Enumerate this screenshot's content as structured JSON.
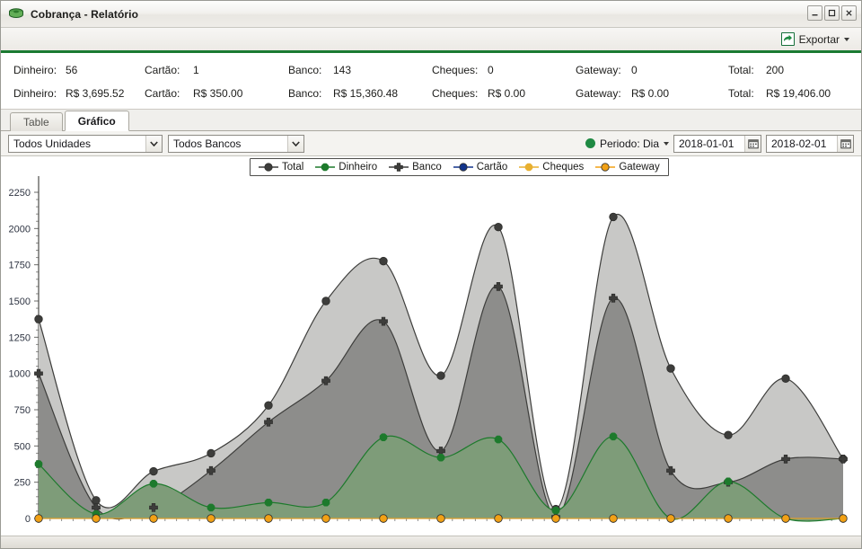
{
  "window": {
    "title": "Cobrança - Relatório",
    "icon": "money-stack-icon",
    "minimize_label": "–",
    "maximize_label": "☐",
    "close_label": "✕"
  },
  "toolbar": {
    "export_label": "Exportar",
    "export_icon": "export-arrow-icon",
    "accent_color": "#1b7a32"
  },
  "summary": {
    "counts": [
      {
        "label": "Dinheiro:",
        "value": "56"
      },
      {
        "label": "Cartão:",
        "value": "1"
      },
      {
        "label": "Banco:",
        "value": "143"
      },
      {
        "label": "Cheques:",
        "value": "0"
      },
      {
        "label": "Gateway:",
        "value": "0"
      },
      {
        "label": "Total:",
        "value": "200"
      }
    ],
    "amounts": [
      {
        "label": "Dinheiro:",
        "value": "R$ 3,695.52"
      },
      {
        "label": "Cartão:",
        "value": "R$ 350.00"
      },
      {
        "label": "Banco:",
        "value": "R$ 15,360.48"
      },
      {
        "label": "Cheques:",
        "value": "R$ 0.00"
      },
      {
        "label": "Gateway:",
        "value": "R$ 0.00"
      },
      {
        "label": "Total:",
        "value": "R$ 19,406.00"
      }
    ]
  },
  "tabs": [
    {
      "label": "Table",
      "active": false
    },
    {
      "label": "Gráfico",
      "active": true
    }
  ],
  "filters": {
    "unidade": {
      "value": "Todos Unidades",
      "arrow": "chevron-down-icon"
    },
    "banco": {
      "value": "Todos Bancos",
      "arrow": "chevron-down-icon"
    },
    "status_dot_color": "#1f8a43",
    "period_label": "Periodo: Dia",
    "period_caret": "caret-down-icon",
    "date_from": "2018-01-01",
    "date_to": "2018-02-01",
    "calendar_icon": "calendar-icon"
  },
  "chart_data": {
    "type": "area",
    "title": "",
    "xlabel": "",
    "ylabel": "",
    "ylim": [
      0,
      2250
    ],
    "yticks": [
      0,
      250,
      500,
      750,
      1000,
      1250,
      1500,
      1750,
      2000,
      2250
    ],
    "ytick_labels": [
      "0",
      "250",
      "500",
      "750",
      "1000",
      "1250",
      "1500",
      "1750",
      "2000",
      "2250"
    ],
    "grid": false,
    "legend_position": "top-center",
    "x_count": 15,
    "series": [
      {
        "name": "Total",
        "color": "#3d3d3b",
        "fill": "#c8c8c6",
        "marker": "circle",
        "values": [
          1375,
          125,
          325,
          450,
          780,
          1500,
          1775,
          985,
          2010,
          65,
          2080,
          1035,
          575,
          965,
          410
        ]
      },
      {
        "name": "Dinheiro",
        "color": "#1d7a2c",
        "fill": "#7e9c79",
        "marker": "star",
        "values": [
          375,
          30,
          240,
          75,
          110,
          110,
          560,
          420,
          545,
          55,
          565,
          0,
          255,
          0,
          0
        ]
      },
      {
        "name": "Banco",
        "color": "#3d3d3b",
        "fill": "#8d8d8b",
        "marker": "plus",
        "values": [
          1000,
          75,
          75,
          330,
          665,
          950,
          1360,
          465,
          1600,
          10,
          1520,
          330,
          250,
          410,
          410
        ]
      },
      {
        "name": "Cartão",
        "color": "#12348c",
        "fill": "none",
        "marker": "circle",
        "values": [
          0,
          0,
          0,
          0,
          0,
          0,
          0,
          0,
          0,
          0,
          0,
          0,
          0,
          0,
          0
        ]
      },
      {
        "name": "Cheques",
        "color": "#e8b030",
        "fill": "none",
        "marker": "star",
        "values": [
          0,
          0,
          0,
          0,
          0,
          0,
          0,
          0,
          0,
          0,
          0,
          0,
          0,
          0,
          0
        ]
      },
      {
        "name": "Gateway",
        "color": "#f2a115",
        "fill": "none",
        "marker": "circle",
        "values": [
          0,
          0,
          0,
          0,
          0,
          0,
          0,
          0,
          0,
          0,
          0,
          0,
          0,
          0,
          0
        ]
      }
    ],
    "legend": [
      "Total",
      "Dinheiro",
      "Banco",
      "Cartão",
      "Cheques",
      "Gateway"
    ]
  }
}
